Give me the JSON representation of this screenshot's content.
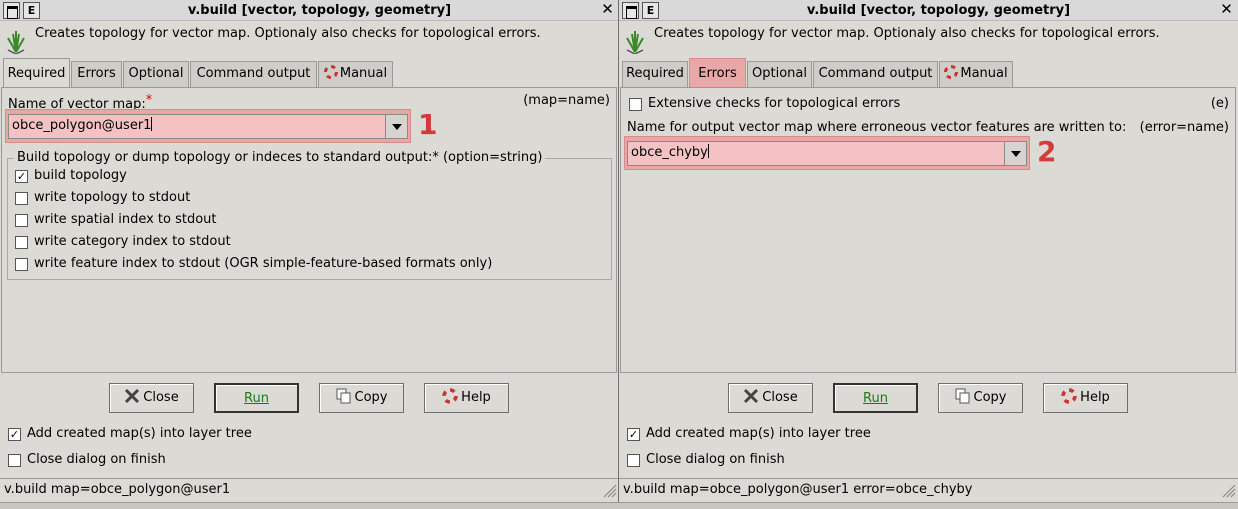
{
  "left": {
    "title": "v.build [vector, topology, geometry]",
    "description": "Creates topology for vector map. Optionaly also checks for topological errors.",
    "tabs": [
      {
        "label": "Required"
      },
      {
        "label": "Errors"
      },
      {
        "label": "Optional"
      },
      {
        "label": "Command output"
      },
      {
        "label": "Manual"
      }
    ],
    "active_tab": "Required",
    "map_label": "Name of vector map:",
    "map_required_mark": "*",
    "map_param": "(map=name)",
    "map_value": "obce_polygon@user1",
    "annotation": "1",
    "group_title": "Build topology or dump topology or indeces to standard output:*  (option=string)",
    "options": [
      {
        "label": "build topology",
        "checked": true
      },
      {
        "label": "write topology to stdout",
        "checked": false
      },
      {
        "label": "write spatial index to stdout",
        "checked": false
      },
      {
        "label": "write category index to stdout",
        "checked": false
      },
      {
        "label": "write feature index to stdout (OGR simple-feature-based formats only)",
        "checked": false
      }
    ],
    "buttons": {
      "close": "Close",
      "run": "Run",
      "copy": "Copy",
      "help": "Help"
    },
    "add_to_tree": {
      "label": "Add created map(s) into layer tree",
      "checked": true
    },
    "close_on_finish": {
      "label": "Close dialog on finish",
      "checked": false
    },
    "status": "v.build map=obce_polygon@user1"
  },
  "right": {
    "title": "v.build [vector, topology, geometry]",
    "description": "Creates topology for vector map. Optionaly also checks for topological errors.",
    "tabs": [
      {
        "label": "Required"
      },
      {
        "label": "Errors"
      },
      {
        "label": "Optional"
      },
      {
        "label": "Command output"
      },
      {
        "label": "Manual"
      }
    ],
    "active_tab": "Errors",
    "extensive_label": "Extensive checks for topological errors",
    "extensive_checked": false,
    "extensive_param": "(e)",
    "error_label": "Name for output vector map where erroneous vector features are written to:",
    "error_param": "(error=name)",
    "error_value": "obce_chyby",
    "annotation": "2",
    "buttons": {
      "close": "Close",
      "run": "Run",
      "copy": "Copy",
      "help": "Help"
    },
    "add_to_tree": {
      "label": "Add created map(s) into layer tree",
      "checked": true
    },
    "close_on_finish": {
      "label": "Close dialog on finish",
      "checked": false
    },
    "status": "v.build map=obce_polygon@user1 error=obce_chyby"
  },
  "colors": {
    "highlight": "#eaa5a5",
    "annotation": "#d23b3b",
    "run_text": "#1a7a1a",
    "required_mark": "#dd0000"
  },
  "icons": {
    "module": "grass-module-icon",
    "close": "close-x-icon",
    "copy": "copy-icon",
    "help": "lifebuoy-help-icon",
    "manual": "lifebuoy-icon"
  }
}
